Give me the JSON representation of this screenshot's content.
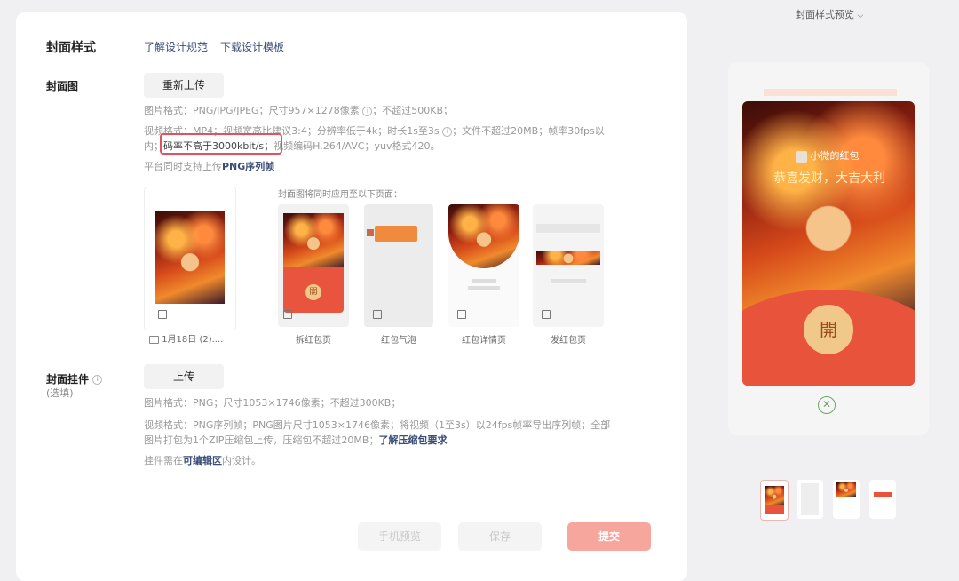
{
  "preview_toggle": {
    "label": "封面样式预览"
  },
  "section": {
    "title": "封面样式",
    "links": [
      "了解设计规范",
      "下载设计模板"
    ]
  },
  "cover": {
    "label": "封面图",
    "reupload_label": "重新上传",
    "help_line1": "图片格式：PNG/JPG/JPEG；尺寸957×1278像素",
    "help_line1_tail": "；不超过500KB；",
    "help_line2a": "视频格式：MP4；视频宽高比建议3:4；分辨率低于4k；时长1s至3s",
    "help_line2b": "；文件不超过20MB；帧率30fps以",
    "help_line3a": "内；",
    "help_highlight": "码率不高于3000kbit/s；",
    "help_line3b": "视频编码H.264/AVC；yuv格式420。",
    "help_line4a": "平台同时支持上传",
    "help_line4b": "PNG序列帧",
    "file_name": "1月18日 (2)....",
    "applied_hint": "封面图将同时应用至以下页面：",
    "pages": [
      "拆红包页",
      "红包气泡",
      "红包详情页",
      "发红包页"
    ],
    "open_char": "開"
  },
  "pendant": {
    "label": "封面挂件",
    "optional": "(选填)",
    "upload_label": "上传",
    "help1": "图片格式：PNG；尺寸1053×1746像素；不超过300KB；",
    "help2a": "视频格式：PNG序列帧；PNG图片尺寸1053×1746像素；将视频（1至3s）以24fps帧率导出序列帧；全部",
    "help2b": "图片打包为1个ZIP压缩包上传，压缩包不超过20MB；",
    "help2_link": "了解压缩包要求",
    "help3a": "挂件需在",
    "help3_link": "可编辑区",
    "help3b": "内设计。"
  },
  "footer": {
    "preview_btn": "手机预览",
    "save_btn": "保存",
    "submit_btn": "提交"
  },
  "preview": {
    "sender": "小微的红包",
    "greeting": "恭喜发财，大吉大利",
    "open_char": "開"
  },
  "colors": {
    "accent_red": "#f07a6e",
    "link_blue": "#3b4d7a",
    "highlight_red": "#e3505f"
  }
}
